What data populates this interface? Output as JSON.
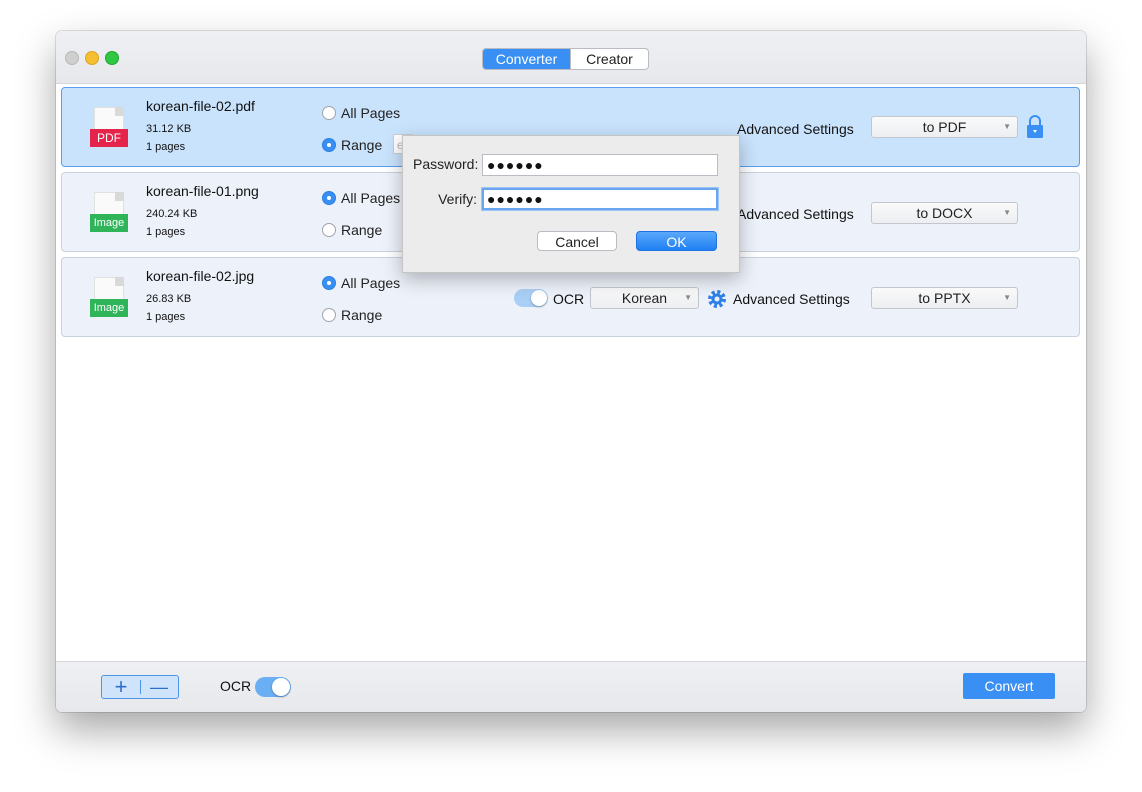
{
  "titlebar": {
    "tabs": [
      {
        "label": "Converter",
        "active": true
      },
      {
        "label": "Creator",
        "active": false
      }
    ]
  },
  "files": [
    {
      "name": "korean-file-02.pdf",
      "size": "31.12 KB",
      "pages": "1 pages",
      "type_tag": "PDF",
      "page_mode": "Range",
      "range_placeholder": "e",
      "all_pages_label": "All Pages",
      "range_label": "Range",
      "advanced_label": "Advanced Settings",
      "output": "to PDF",
      "locked": true,
      "selected": true
    },
    {
      "name": "korean-file-01.png",
      "size": "240.24 KB",
      "pages": "1 pages",
      "type_tag": "Image",
      "page_mode": "All Pages",
      "all_pages_label": "All Pages",
      "range_label": "Range",
      "advanced_label": "Advanced Settings",
      "output": "to DOCX"
    },
    {
      "name": "korean-file-02.jpg",
      "size": "26.83 KB",
      "pages": "1 pages",
      "type_tag": "Image",
      "page_mode": "All Pages",
      "all_pages_label": "All Pages",
      "range_label": "Range",
      "ocr_label": "OCR",
      "ocr_on": true,
      "language": "Korean",
      "advanced_label": "Advanced Settings",
      "output": "to PPTX"
    }
  ],
  "dialog": {
    "password_label": "Password:",
    "password_value": "●●●●●●",
    "verify_label": "Verify:",
    "verify_value": "●●●●●●",
    "cancel_label": "Cancel",
    "ok_label": "OK"
  },
  "bottombar": {
    "add_label": "+",
    "remove_label": "—",
    "ocr_label": "OCR",
    "ocr_on": true,
    "convert_label": "Convert"
  },
  "colors": {
    "accent": "#3a8ff5",
    "pdf_tag": "#e4244a",
    "image_tag": "#2fb45a",
    "selected_row": "#c9e3fd"
  }
}
